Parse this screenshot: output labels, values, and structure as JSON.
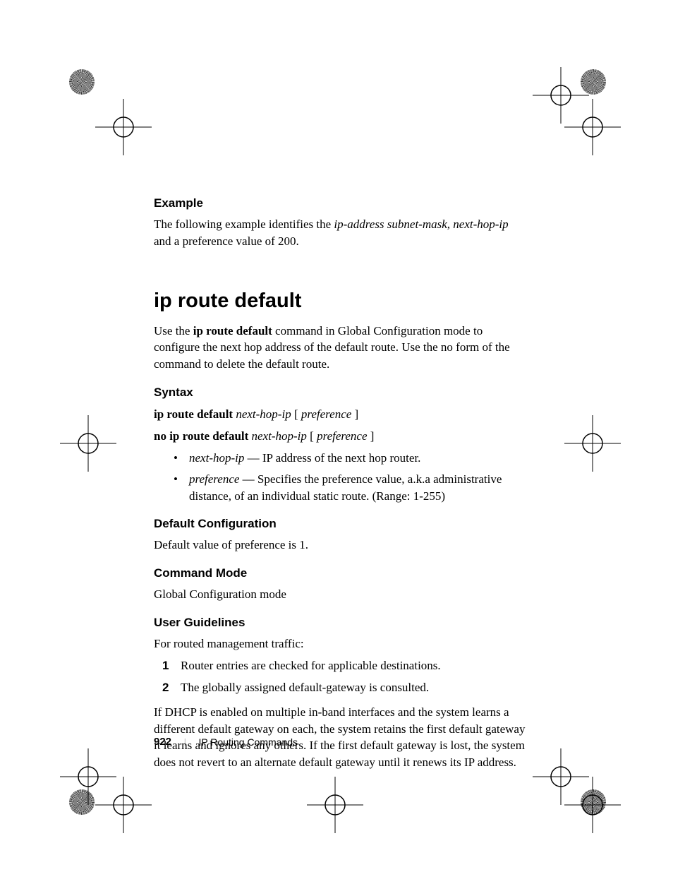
{
  "example": {
    "heading": "Example",
    "text_before_italic": "The following example identifies the ",
    "text_italic": "ip-address subnet-mask, next-hop-ip",
    "text_after_italic": " and a preference value of 200."
  },
  "command": {
    "title": "ip route default",
    "intro_before_bold": "Use the ",
    "intro_bold": "ip route default",
    "intro_after_bold": " command in Global Configuration mode to configure the next hop address of the default route. Use the no form of the command to delete the default route."
  },
  "syntax": {
    "heading": "Syntax",
    "line1_bold": "ip route default ",
    "line1_italic1": "next-hop-ip",
    "line1_plain1": " [ ",
    "line1_italic2": "preference",
    "line1_plain2": " ]",
    "line2_bold": "no ip route default ",
    "line2_italic1": "next-hop-ip",
    "line2_plain1": " [ ",
    "line2_italic2": "preference",
    "line2_plain2": " ]",
    "bullets": [
      {
        "term": "next-hop-ip",
        "desc": " — IP address of the next hop router."
      },
      {
        "term": "preference",
        "desc": " — Specifies the preference value, a.k.a administrative distance, of an individual static route. (Range: 1-255)"
      }
    ]
  },
  "default_config": {
    "heading": "Default Configuration",
    "text": "Default value of preference is 1."
  },
  "command_mode": {
    "heading": "Command Mode",
    "text": "Global Configuration mode"
  },
  "user_guidelines": {
    "heading": "User Guidelines",
    "intro": "For routed management traffic:",
    "steps": [
      "Router entries are checked for applicable destinations.",
      "The globally assigned default-gateway is consulted."
    ],
    "conclusion": "If DHCP is enabled on multiple in-band interfaces and the system learns a different default gateway on each, the system retains the first default gateway it learns and ignores any others. If the first default gateway is lost, the system does not revert to an alternate default gateway until it renews its IP address."
  },
  "footer": {
    "page": "922",
    "chapter": "IP Routing Commands"
  }
}
